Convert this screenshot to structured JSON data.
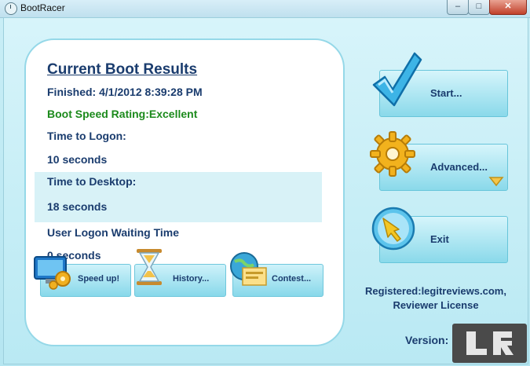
{
  "window": {
    "title": "BootRacer",
    "min_symbol": "–",
    "max_symbol": "□",
    "close_symbol": "✕"
  },
  "results": {
    "heading": "Current Boot Results",
    "finished": "Finished: 4/1/2012 8:39:28 PM",
    "rating": "Boot Speed Rating:Excellent",
    "logon_label": "Time to Logon:",
    "logon_value": "10 seconds",
    "desktop_label": "Time to Desktop:",
    "desktop_value": "18 seconds",
    "waiting_label": "User Logon Waiting Time",
    "waiting_value": "0 seconds"
  },
  "actions": {
    "speed_up": "Speed up!",
    "history": "History...",
    "contest": "Contest..."
  },
  "main_buttons": {
    "start": "Start...",
    "advanced": "Advanced...",
    "exit": "Exit"
  },
  "registration": {
    "line1": "Registered:legitreviews.com,",
    "line2": "Reviewer License",
    "version_label": "Version:"
  },
  "colors": {
    "accent": "#1a3c6e",
    "rating_green": "#1b8a1b",
    "button_fill": "#9ee0ef"
  }
}
